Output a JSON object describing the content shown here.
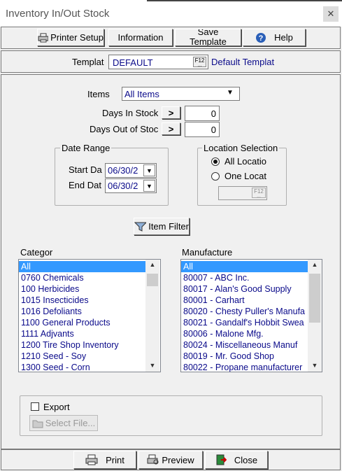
{
  "window": {
    "title": "Inventory In/Out Stock",
    "close_glyph": "✕"
  },
  "toolbar": {
    "printer_setup": "Printer Setup",
    "information": "Information",
    "save_template": "Save Template",
    "help": "Help"
  },
  "template": {
    "label": "Templat",
    "value": "DEFAULT",
    "f12": "F12",
    "description": "Default Templat"
  },
  "items": {
    "label": "Items",
    "value": "All Items"
  },
  "days_in_stock": {
    "label": "Days In Stock",
    "op": ">",
    "value": "0"
  },
  "days_out_of_stock": {
    "label": "Days Out of Stoc",
    "op": ">",
    "value": "0"
  },
  "date_range": {
    "title": "Date Range",
    "start_label": "Start Da",
    "start_value": "06/30/2",
    "end_label": "End Dat",
    "end_value": "06/30/2"
  },
  "location": {
    "title": "Location Selection",
    "all_label": "All Locatio",
    "one_label": "One Locat",
    "f12": "F12"
  },
  "item_filter": {
    "label": "Item Filter"
  },
  "category": {
    "label": "Categor",
    "items": [
      "All",
      "0760 Chemicals",
      "100 Herbicides",
      "1015 Insecticides",
      "1016 Defoliants",
      "1100 General Products",
      "1111 Adjvants",
      "1200 Tire Shop Inventory",
      "1210 Seed - Soy",
      "1300 Seed - Corn"
    ]
  },
  "manufacture": {
    "label": "Manufacture",
    "items": [
      "All",
      "80007 - ABC Inc.",
      "80017 - Alan's Good Supply",
      "80001 - Carhart",
      "80020 - Chesty Puller's Manufa",
      "80021 - Gandalf's Hobbit Swea",
      "80006 - Malone Mfg.",
      "80024 - Miscellaneous Manuf",
      "80019 - Mr. Good Shop",
      "80022 - Propane manufacturer"
    ]
  },
  "export": {
    "label": "Export",
    "select_file": "Select File..."
  },
  "bottom": {
    "print": "Print",
    "preview": "Preview",
    "close": "Close"
  }
}
